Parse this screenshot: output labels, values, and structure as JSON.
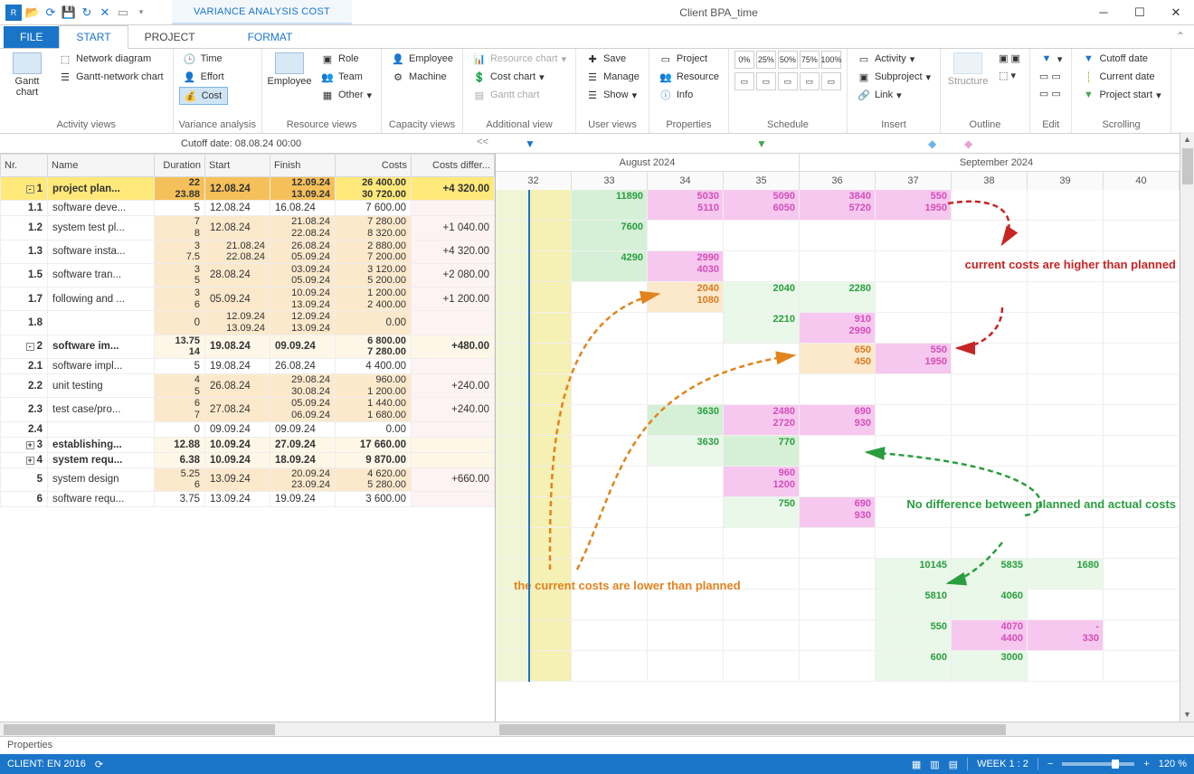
{
  "titlebar": {
    "contextual": "VARIANCE ANALYSIS COST",
    "document": "Client BPA_time"
  },
  "tabs": {
    "file": "FILE",
    "start": "START",
    "project": "PROJECT",
    "format": "FORMAT"
  },
  "ribbon": {
    "gantt": "Gantt chart",
    "netdiag": "Network diagram",
    "gncChart": "Gantt-network chart",
    "activity_views": "Activity views",
    "time": "Time",
    "effort": "Effort",
    "cost": "Cost",
    "variance": "Variance analysis",
    "employee": "Employee",
    "role": "Role",
    "team": "Team",
    "other": "Other",
    "resviews": "Resource views",
    "employee2": "Employee",
    "machine": "Machine",
    "capviews": "Capacity views",
    "reschart": "Resource chart",
    "costchart": "Cost chart",
    "ganttchart": "Gantt chart",
    "addview": "Additional view",
    "save": "Save",
    "manage": "Manage",
    "show": "Show",
    "userviews": "User views",
    "project": "Project",
    "resource": "Resource",
    "info": "Info",
    "properties": "Properties",
    "schedule": "Schedule",
    "activity": "Activity",
    "subproject": "Subproject",
    "link": "Link",
    "insert": "Insert",
    "structure": "Structure",
    "outline": "Outline",
    "edit": "Edit",
    "cutoff": "Cutoff date",
    "curdate": "Current date",
    "projstart": "Project start",
    "scrolling": "Scrolling",
    "pct0": "0%",
    "pct25": "25%",
    "pct50": "50%",
    "pct75": "75%",
    "pct100": "100%"
  },
  "cutoff": {
    "label": "Cutoff date:  08.08.24 00:00",
    "collapse": "<<"
  },
  "columns": {
    "nr": "Nr.",
    "name": "Name",
    "dur": "Duration",
    "start": "Start",
    "finish": "Finish",
    "costs": "Costs",
    "diff": "Costs differ..."
  },
  "months": {
    "aug": "August 2024",
    "sep": "September 2024"
  },
  "weeks": [
    "32",
    "33",
    "34",
    "35",
    "36",
    "37",
    "38",
    "39",
    "40"
  ],
  "rows": [
    {
      "nr": "1",
      "name": "project plan...",
      "dur": "22\n23.88",
      "start": "12.08.24",
      "fin": "12.09.24\n13.09.24",
      "costs": "26 400.00\n30 720.00",
      "diff": "+4 320.00",
      "top": true,
      "hl": true,
      "exp": "-",
      "cells": {
        "33": {
          "v": "11890",
          "c": "bg-green txt-green"
        },
        "34": {
          "v": "5030\n5110",
          "c": "bg-pink txt-pink"
        },
        "35": {
          "v": "5090\n6050",
          "c": "bg-pink txt-pink"
        },
        "36": {
          "v": "3840\n5720",
          "c": "bg-pink txt-pink"
        },
        "37": {
          "v": "550\n1950",
          "c": "bg-pink txt-pink"
        }
      }
    },
    {
      "nr": "1.1",
      "name": "software deve...",
      "dur": "5",
      "start": "12.08.24",
      "fin": "16.08.24",
      "costs": "7 600.00",
      "diff": "",
      "cells": {
        "33": {
          "v": "7600",
          "c": "bg-green txt-green"
        }
      }
    },
    {
      "nr": "1.2",
      "name": "system test pl...",
      "dur": "7\n8",
      "start": "12.08.24",
      "fin": "21.08.24\n22.08.24",
      "costs": "7 280.00\n8 320.00",
      "diff": "+1 040.00",
      "tan": true,
      "cells": {
        "33": {
          "v": "4290",
          "c": "bg-green txt-green"
        },
        "34": {
          "v": "2990\n4030",
          "c": "bg-pink txt-pink"
        }
      }
    },
    {
      "nr": "1.3",
      "name": "software insta...",
      "dur": "3\n7.5",
      "start": "21.08.24\n22.08.24",
      "fin": "26.08.24\n05.09.24",
      "costs": "2 880.00\n7 200.00",
      "diff": "+4 320.00",
      "tan": true,
      "cells": {
        "34": {
          "v": "2040\n1080",
          "c": "bg-tan txt-orange"
        },
        "35": {
          "v": "2040",
          "c": "bg-ltgreen txt-green"
        },
        "36": {
          "v": "2280",
          "c": "bg-ltgreen txt-green"
        }
      }
    },
    {
      "nr": "1.5",
      "name": "software tran...",
      "dur": "3\n5",
      "start": "28.08.24",
      "fin": "03.09.24\n05.09.24",
      "costs": "3 120.00\n5 200.00",
      "diff": "+2 080.00",
      "tan": true,
      "cells": {
        "35": {
          "v": "2210",
          "c": "bg-ltgreen txt-green"
        },
        "36": {
          "v": "910\n2990",
          "c": "bg-pink txt-pink"
        }
      }
    },
    {
      "nr": "1.7",
      "name": "following and ...",
      "dur": "3\n6",
      "start": "05.09.24",
      "fin": "10.09.24\n13.09.24",
      "costs": "1 200.00\n2 400.00",
      "diff": "+1 200.00",
      "tan": true,
      "cells": {
        "36": {
          "v": "650\n450",
          "c": "bg-tan txt-orange"
        },
        "37": {
          "v": "550\n1950",
          "c": "bg-pink txt-pink"
        }
      }
    },
    {
      "nr": "1.8",
      "name": "",
      "dur": "0",
      "start": "12.09.24\n13.09.24",
      "fin": "12.09.24\n13.09.24",
      "costs": "0.00",
      "diff": "",
      "tan": true,
      "cells": {}
    },
    {
      "nr": "2",
      "name": "software im...",
      "dur": "13.75\n14",
      "start": "19.08.24",
      "fin": "09.09.24",
      "costs": "6 800.00\n7 280.00",
      "diff": "+480.00",
      "top": true,
      "exp": "-",
      "lty": true,
      "cells": {
        "34": {
          "v": "3630",
          "c": "bg-green txt-green"
        },
        "35": {
          "v": "2480\n2720",
          "c": "bg-pink txt-pink"
        },
        "36": {
          "v": "690\n930",
          "c": "bg-pink txt-pink"
        }
      }
    },
    {
      "nr": "2.1",
      "name": "software impl...",
      "dur": "5",
      "start": "19.08.24",
      "fin": "26.08.24",
      "costs": "4 400.00",
      "diff": "",
      "cells": {
        "34": {
          "v": "3630",
          "c": "bg-ltgreen txt-green"
        },
        "35": {
          "v": "770",
          "c": "bg-green txt-green"
        }
      }
    },
    {
      "nr": "2.2",
      "name": "unit testing",
      "dur": "4\n5",
      "start": "26.08.24",
      "fin": "29.08.24\n30.08.24",
      "costs": "960.00\n1 200.00",
      "diff": "+240.00",
      "tan": true,
      "cells": {
        "35": {
          "v": "960\n1200",
          "c": "bg-pink txt-pink"
        }
      }
    },
    {
      "nr": "2.3",
      "name": "test case/pro...",
      "dur": "6\n7",
      "start": "27.08.24",
      "fin": "05.09.24\n06.09.24",
      "costs": "1 440.00\n1 680.00",
      "diff": "+240.00",
      "tan": true,
      "cells": {
        "35": {
          "v": "750",
          "c": "bg-ltgreen txt-green"
        },
        "36": {
          "v": "690\n930",
          "c": "bg-pink txt-pink"
        }
      }
    },
    {
      "nr": "2.4",
      "name": "",
      "dur": "0",
      "start": "09.09.24",
      "fin": "09.09.24",
      "costs": "0.00",
      "diff": "",
      "cells": {}
    },
    {
      "nr": "3",
      "name": "establishing...",
      "dur": "12.88",
      "start": "10.09.24",
      "fin": "27.09.24",
      "costs": "17 660.00",
      "diff": "",
      "top": true,
      "exp": "+",
      "lty": true,
      "cells": {
        "37": {
          "v": "10145",
          "c": "bg-ltgreen txt-green"
        },
        "38": {
          "v": "5835",
          "c": "bg-ltgreen txt-green"
        },
        "39": {
          "v": "1680",
          "c": "bg-ltgreen txt-green"
        }
      }
    },
    {
      "nr": "4",
      "name": "system requ...",
      "dur": "6.38",
      "start": "10.09.24",
      "fin": "18.09.24",
      "costs": "9 870.00",
      "diff": "",
      "top": true,
      "exp": "+",
      "lty": true,
      "cells": {
        "37": {
          "v": "5810",
          "c": "bg-ltgreen txt-green"
        },
        "38": {
          "v": "4060",
          "c": "bg-ltgreen txt-green"
        }
      }
    },
    {
      "nr": "5",
      "name": "system design",
      "dur": "5.25\n6",
      "start": "13.09.24",
      "fin": "20.09.24\n23.09.24",
      "costs": "4 620.00\n5 280.00",
      "diff": "+660.00",
      "tan": true,
      "cells": {
        "37": {
          "v": "550",
          "c": "bg-ltgreen txt-green"
        },
        "38": {
          "v": "4070\n4400",
          "c": "bg-pink txt-pink"
        },
        "39": {
          "v": "-\n330",
          "c": "bg-pink txt-pink"
        }
      }
    },
    {
      "nr": "6",
      "name": "software requ...",
      "dur": "3.75",
      "start": "13.09.24",
      "fin": "19.09.24",
      "costs": "3 600.00",
      "diff": "",
      "cells": {
        "37": {
          "v": "600",
          "c": "bg-ltgreen txt-green"
        },
        "38": {
          "v": "3000",
          "c": "bg-ltgreen txt-green"
        }
      }
    }
  ],
  "annotations": {
    "red": "current costs are higher than planned",
    "orange": "the current costs are lower than planned",
    "green": "No difference between planned and actual costs"
  },
  "propbar": "Properties",
  "status": {
    "client": "CLIENT: EN 2016",
    "week": "WEEK 1 : 2",
    "zoom": "120 %"
  }
}
